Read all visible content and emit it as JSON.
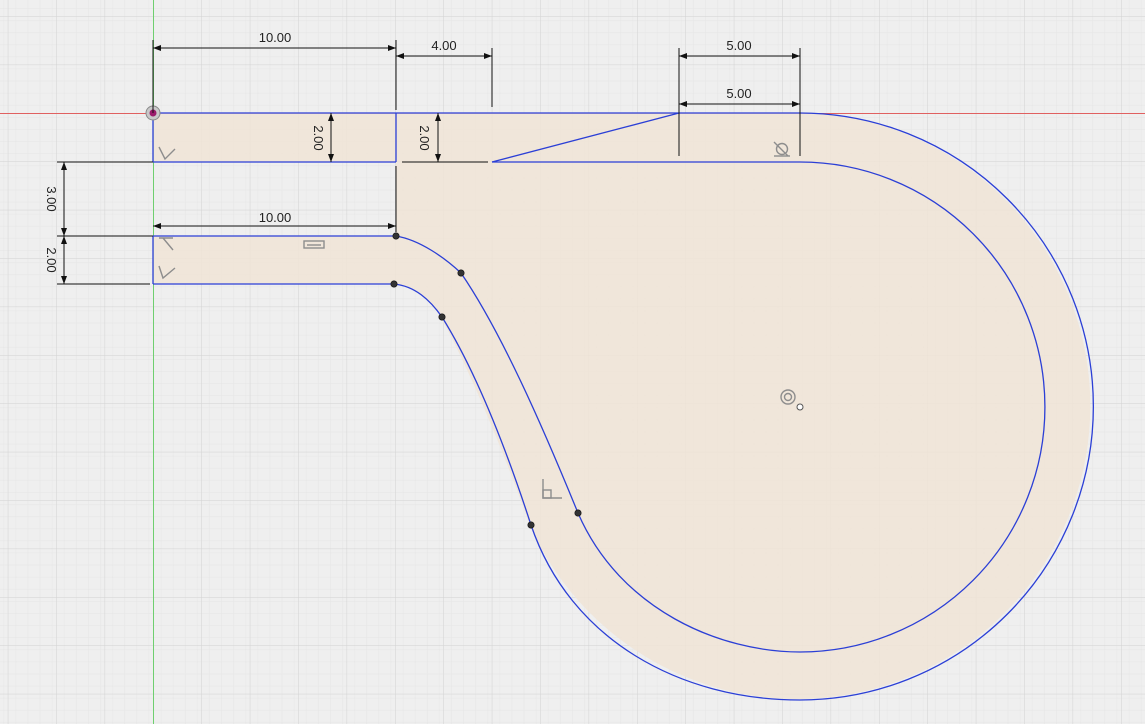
{
  "dimensions": {
    "top_width": "10.00",
    "gap_width": "4.00",
    "angled_width": "5.00",
    "tip_width": "5.00",
    "left_slot_height": "2.00",
    "right_slot_height": "2.00",
    "spacer_height": "3.00",
    "bottom_slot_height": "2.00",
    "mid_width": "10.00"
  },
  "icons": {
    "origin": "origin-point-icon",
    "coincident_constraints": "perpendicular-constraint-icon",
    "tangent_constraint": "tangent-constraint-icon",
    "parallel_constraint": "parallel-constraint-icon",
    "concentric_constraint": "concentric-constraint-icon",
    "right_angle_constraint": "right-angle-constraint-icon"
  },
  "colors": {
    "background": "#efefef",
    "grid_major": "#d6d6d6",
    "grid_minor": "#e3e3e3",
    "x_axis": "#e06060",
    "y_axis": "#6fcf6f",
    "sketch_line": "#2b3fd6",
    "profile_fill": "#f0e4d6"
  }
}
